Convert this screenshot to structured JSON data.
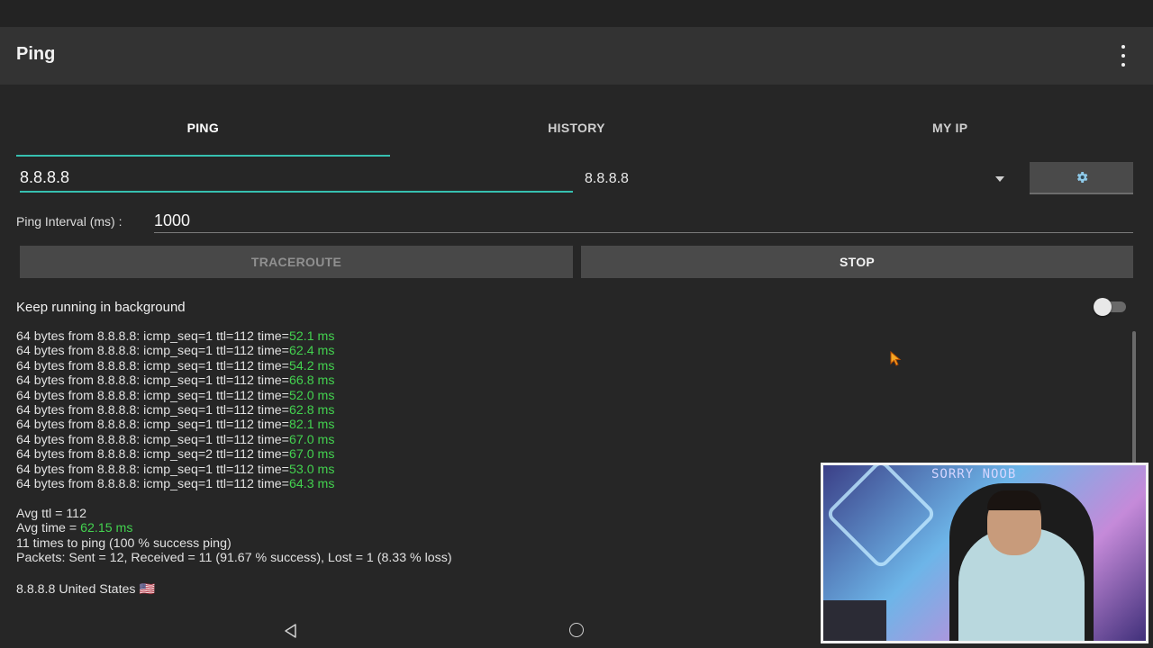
{
  "app": {
    "title": "Ping"
  },
  "tabs": [
    {
      "label": "PING",
      "active": true
    },
    {
      "label": "HISTORY",
      "active": false
    },
    {
      "label": "MY IP",
      "active": false
    }
  ],
  "host": {
    "input_value": "8.8.8.8",
    "selected_option": "8.8.8.8",
    "settings_icon": "gear-icon"
  },
  "interval": {
    "label": "Ping Interval (ms) :",
    "value": "1000"
  },
  "buttons": {
    "traceroute": "TRACEROUTE",
    "stop": "STOP"
  },
  "background": {
    "label": "Keep running in background",
    "enabled": false
  },
  "log": {
    "lines": [
      {
        "text": "64 bytes from 8.8.8.8: icmp_seq=1 ttl=112 time=",
        "time": "52.1 ms"
      },
      {
        "text": "64 bytes from 8.8.8.8: icmp_seq=1 ttl=112 time=",
        "time": "62.4 ms"
      },
      {
        "text": "64 bytes from 8.8.8.8: icmp_seq=1 ttl=112 time=",
        "time": "54.2 ms"
      },
      {
        "text": "64 bytes from 8.8.8.8: icmp_seq=1 ttl=112 time=",
        "time": "66.8 ms"
      },
      {
        "text": "64 bytes from 8.8.8.8: icmp_seq=1 ttl=112 time=",
        "time": "52.0 ms"
      },
      {
        "text": "64 bytes from 8.8.8.8: icmp_seq=1 ttl=112 time=",
        "time": "62.8 ms"
      },
      {
        "text": "64 bytes from 8.8.8.8: icmp_seq=1 ttl=112 time=",
        "time": "82.1 ms"
      },
      {
        "text": "64 bytes from 8.8.8.8: icmp_seq=1 ttl=112 time=",
        "time": "67.0 ms"
      },
      {
        "text": "64 bytes from 8.8.8.8: icmp_seq=2 ttl=112 time=",
        "time": "67.0 ms"
      },
      {
        "text": "64 bytes from 8.8.8.8: icmp_seq=1 ttl=112 time=",
        "time": "53.0 ms"
      },
      {
        "text": "64 bytes from 8.8.8.8: icmp_seq=1 ttl=112 time=",
        "time": "64.3 ms"
      }
    ]
  },
  "stats": {
    "avg_ttl": "Avg ttl = 112",
    "avg_time_label": "Avg time = ",
    "avg_time_value": "62.15 ms",
    "times": "11 times to ping (100 % success ping)",
    "packets": "Packets: Sent = 12, Received = 11 (91.67 % success), Lost = 1 (8.33 % loss)"
  },
  "location": {
    "text": "8.8.8.8 United States",
    "flag": "🇺🇸"
  },
  "webcam": {
    "sign_text": "SORRY NOOB"
  },
  "colors": {
    "accent": "#36c0b0",
    "ok_time": "#43d24f",
    "background": "#262626",
    "appbar": "#333333"
  }
}
